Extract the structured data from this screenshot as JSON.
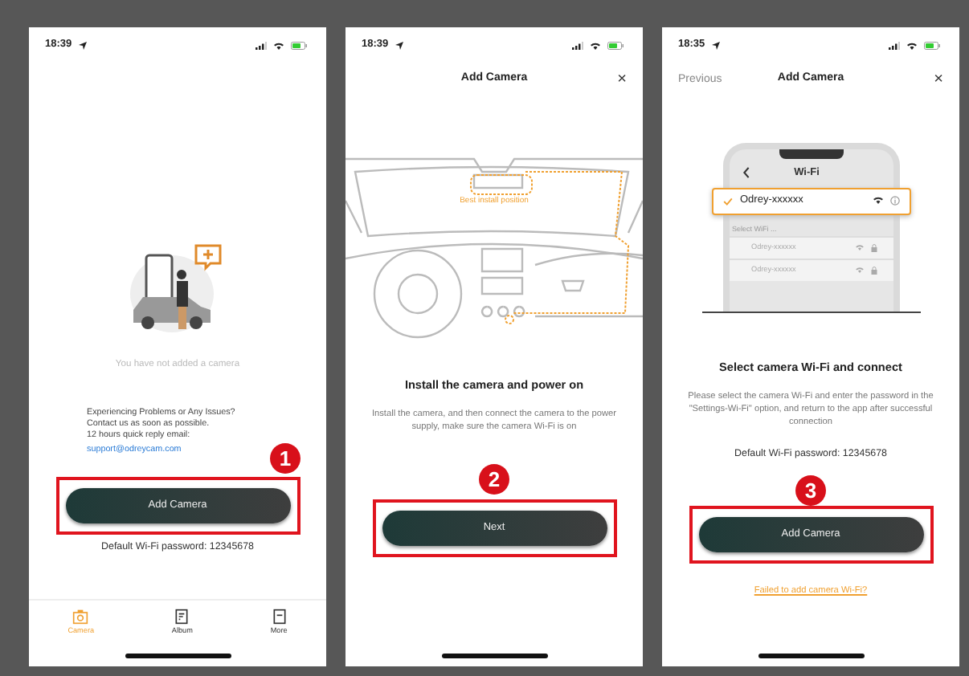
{
  "screens": [
    {
      "kind": "home",
      "time": "18:39",
      "empty_text": "You have not added a camera",
      "help_text": "Experiencing Problems or Any Issues?\nContact us as soon as possible.\n12 hours quick reply email:",
      "email": "support@odreycam.com",
      "step": "1",
      "button": "Add Camera",
      "password": "Default Wi-Fi password: 12345678",
      "tabs": [
        {
          "label": "Camera",
          "selected": true
        },
        {
          "label": "Album",
          "selected": false
        },
        {
          "label": "More",
          "selected": false
        }
      ]
    },
    {
      "kind": "install",
      "time": "18:39",
      "nav": {
        "title": "Add Camera",
        "close": "×"
      },
      "drawing_label": "Best install position",
      "title": "Install the camera and power on",
      "description": "Install the camera, and then connect the camera to the power supply, make sure the camera Wi-Fi is on",
      "step": "2",
      "button": "Next"
    },
    {
      "kind": "wifi",
      "time": "18:35",
      "nav": {
        "back": "Previous",
        "title": "Add Camera",
        "close": "×"
      },
      "phone": {
        "header": "Wi-Fi",
        "selected_network": "Odrey-xxxxxx",
        "list_label": "Select WiFi ...",
        "networks": [
          "Odrey-xxxxxx",
          "Odrey-xxxxxx"
        ]
      },
      "title": "Select camera Wi-Fi and connect",
      "description": "Please select the camera Wi-Fi and enter the password in the \"Settings-Wi-Fi\" option, and return to the app after successful connection",
      "password": "Default Wi-Fi password: 12345678",
      "step": "3",
      "button": "Add Camera",
      "link": "Failed to add camera Wi-Fi?"
    }
  ]
}
